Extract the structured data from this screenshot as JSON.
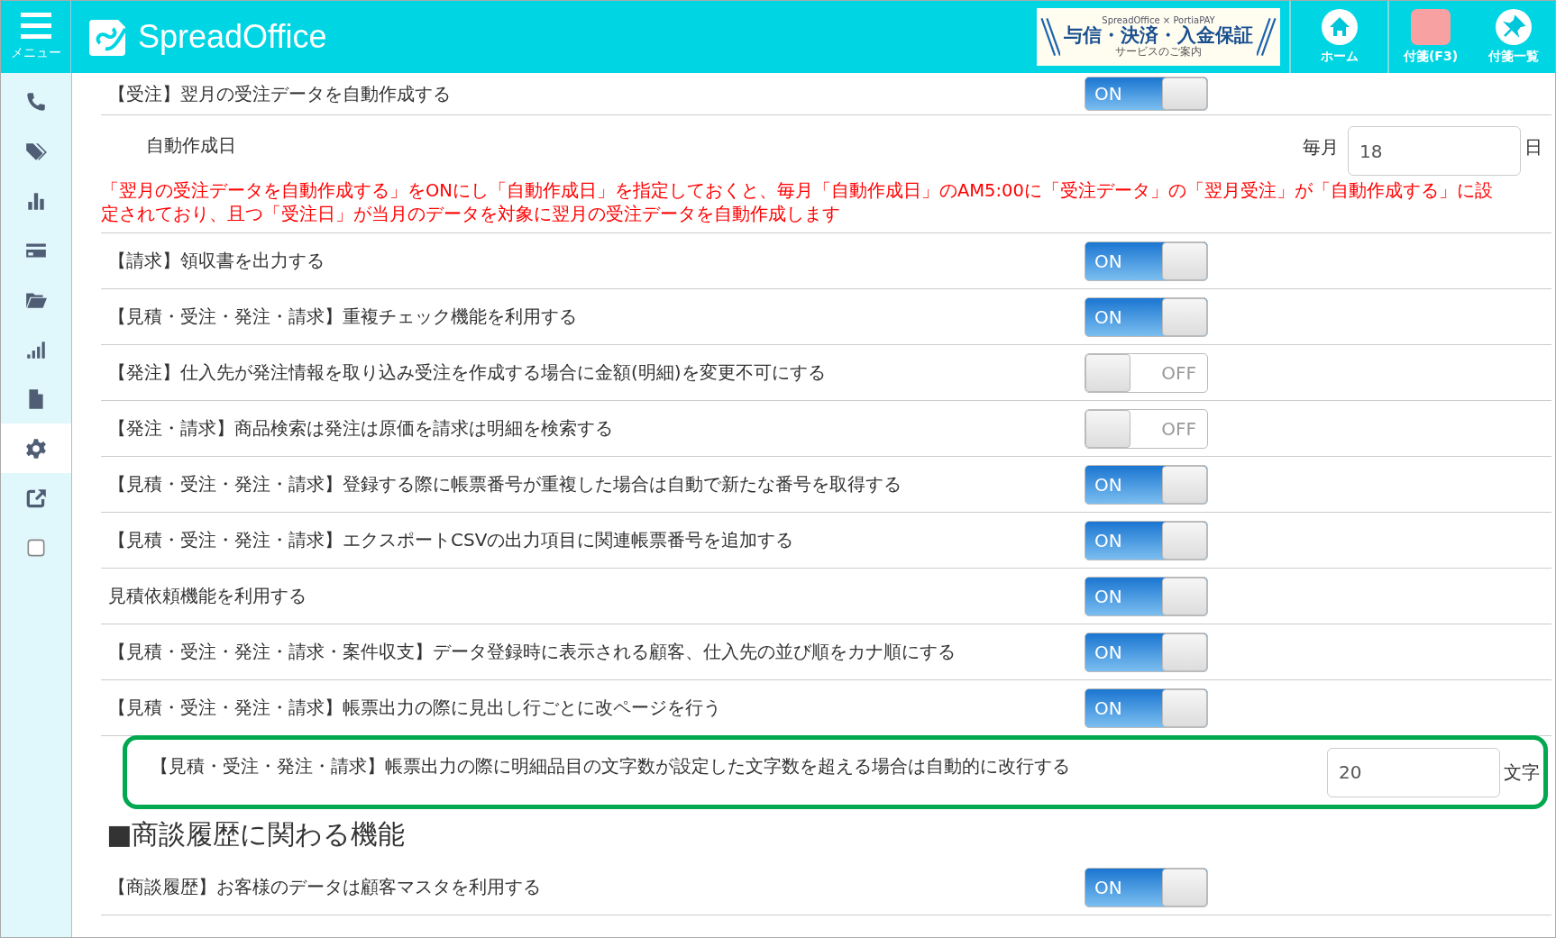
{
  "header": {
    "menu_label": "メニュー",
    "logo": "SpreadOffice",
    "banner": {
      "brand": "SpreadOffice × PortiaPAY",
      "headline": "与信・決済・入金保証",
      "subline": "サービスのご案内"
    },
    "buttons": [
      {
        "kind": "home",
        "label": "ホーム"
      },
      {
        "kind": "sticky",
        "label": "付箋(F3)"
      },
      {
        "kind": "sticky-list",
        "label": "付箋一覧"
      }
    ]
  },
  "sidebar": {
    "items": [
      {
        "selected": false
      },
      {
        "selected": false
      },
      {
        "selected": false
      },
      {
        "selected": false
      },
      {
        "selected": false
      },
      {
        "selected": false
      },
      {
        "selected": false
      },
      {
        "selected": true
      },
      {
        "selected": false
      },
      {
        "selected": false
      }
    ]
  },
  "settings": [
    {
      "kind": "toggle",
      "label": "【受注】翌月の受注データを自動作成する",
      "on": true,
      "state_text": "ON"
    },
    {
      "kind": "day",
      "label": "自動作成日",
      "prefix": "毎月",
      "value": "18",
      "suffix": "日"
    },
    {
      "kind": "note",
      "text": "「翌月の受注データを自動作成する」をONにし「自動作成日」を指定しておくと、毎月「自動作成日」のAM5:00に「受注データ」の「翌月受注」が「自動作成する」に設定されており、且つ「受注日」が当月のデータを対象に翌月の受注データを自動作成します"
    },
    {
      "kind": "toggle",
      "label": "【請求】領収書を出力する",
      "on": true,
      "state_text": "ON"
    },
    {
      "kind": "toggle",
      "label": "【見積・受注・発注・請求】重複チェック機能を利用する",
      "on": true,
      "state_text": "ON"
    },
    {
      "kind": "toggle",
      "label": "【発注】仕入先が発注情報を取り込み受注を作成する場合に金額(明細)を変更不可にする",
      "on": false,
      "state_text": "OFF"
    },
    {
      "kind": "toggle",
      "label": "【発注・請求】商品検索は発注は原価を請求は明細を検索する",
      "on": false,
      "state_text": "OFF"
    },
    {
      "kind": "toggle",
      "label": "【見積・受注・発注・請求】登録する際に帳票番号が重複した場合は自動で新たな番号を取得する",
      "on": true,
      "state_text": "ON"
    },
    {
      "kind": "toggle",
      "label": "【見積・受注・発注・請求】エクスポートCSVの出力項目に関連帳票番号を追加する",
      "on": true,
      "state_text": "ON"
    },
    {
      "kind": "toggle",
      "label": "見積依頼機能を利用する",
      "on": true,
      "state_text": "ON"
    },
    {
      "kind": "toggle",
      "label": "【見積・受注・発注・請求・案件収支】データ登録時に表示される顧客、仕入先の並び順をカナ順にする",
      "on": true,
      "state_text": "ON"
    },
    {
      "kind": "toggle",
      "label": "【見積・受注・発注・請求】帳票出力の際に見出し行ごとに改ページを行う",
      "on": true,
      "state_text": "ON"
    },
    {
      "kind": "count",
      "label": "【見積・受注・発注・請求】帳票出力の際に明細品目の文字数が設定した文字数を超える場合は自動的に改行する",
      "value": "20",
      "suffix": "文字",
      "highlighted": true
    },
    {
      "kind": "heading",
      "text": "■商談履歴に関わる機能"
    },
    {
      "kind": "toggle",
      "label": "【商談履歴】お客様のデータは顧客マスタを利用する",
      "on": true,
      "state_text": "ON"
    }
  ]
}
